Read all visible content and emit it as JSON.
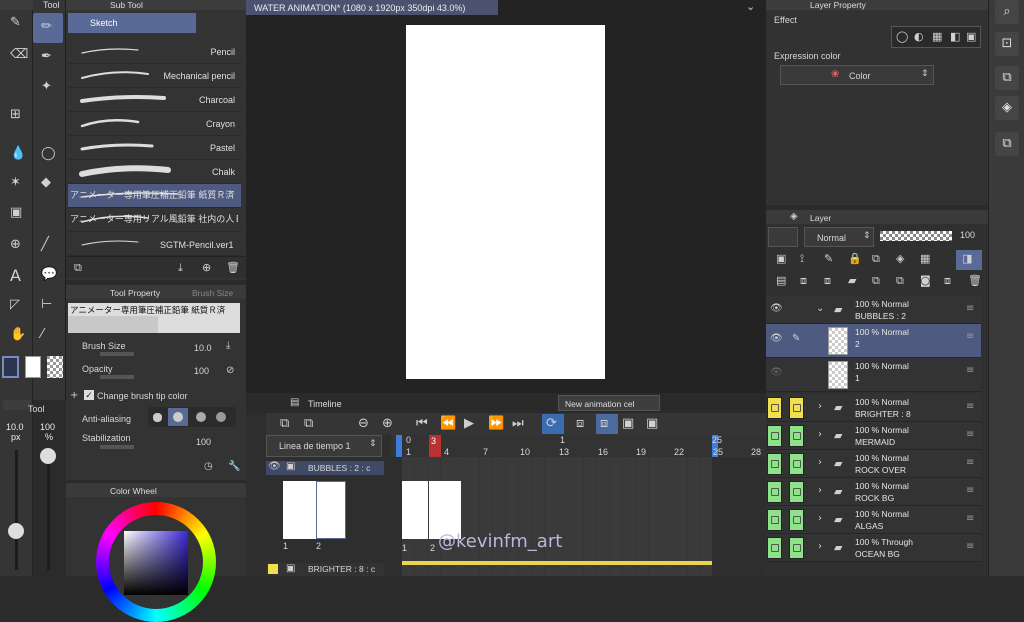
{
  "colors": {
    "accent": "#5a6a96",
    "selection_blue": "#3c7ddc",
    "highlight_red": "#d23c3c",
    "yellow_flag": "#f0e050",
    "green_flag": "#8ee38a"
  },
  "tools": {
    "title": "Tool",
    "icons": [
      "pen-icon",
      "eraser-icon",
      "transform-grid-icon",
      "dropper-fill-icon",
      "magic-wand-icon",
      "gradient-icon",
      "object-select-icon",
      "text-icon",
      "figure-icon",
      "hand-icon"
    ],
    "icons2": [
      "pencil-brush-icon",
      "marker-icon",
      "sparkle-icon",
      "lasso-icon",
      "bucket-icon",
      "line-icon",
      "balloon-icon",
      "ruler-icon",
      "eyedropper-icon"
    ]
  },
  "subtool": {
    "title": "Sub Tool",
    "group": "Sketch",
    "brushes": [
      "Pencil",
      "Mechanical pencil",
      "Charcoal",
      "Crayon",
      "Pastel",
      "Chalk",
      "アニメーター専用筆圧補正鉛筆 紙質Ｒ済",
      "アニメーター専用リアル風鉛筆 社内の人Ｅ",
      "SGTM-Pencil.ver1"
    ],
    "selected_index": 6
  },
  "toolprop": {
    "tab1": "Tool Property",
    "tab2": "Brush Size",
    "preview_name": "アニメーター専用筆圧補正鉛筆 紙質Ｒ済",
    "brush_size_label": "Brush Size",
    "brush_size_value": "10.0",
    "opacity_label": "Opacity",
    "opacity_value": "100",
    "change_tip_label": "Change brush tip color",
    "anti_alias_label": "Anti-aliasing",
    "stabilization_label": "Stabilization",
    "stabilization_value": "100"
  },
  "sizebar": {
    "title": "Tool",
    "size": "10.0",
    "size_unit": "px",
    "opacity": "100",
    "opacity_unit": "%"
  },
  "colorwheel": {
    "title": "Color Wheel"
  },
  "document": {
    "title": "WATER ANIMATION* (1080 x 1920px 350dpi 43.0%)"
  },
  "timeline": {
    "title": "Timeline",
    "tooltip": "New animation cel",
    "track_name": "Linea de tiempo 1",
    "frame_numbers": [
      "0",
      "1",
      "4",
      "7",
      "10",
      "13",
      "16",
      "19",
      "22",
      "25",
      "28"
    ],
    "current_frame": "3",
    "marker_top": "1",
    "marker_end": "25",
    "track_bubbles": "BUBBLES : 2 : c",
    "track_brighter": "BRIGHTER : 8 : c",
    "cel_labels": [
      "1",
      "2"
    ],
    "watermark": "@kevinfm_art"
  },
  "layerprop": {
    "title": "Layer Property",
    "effect_label": "Effect",
    "expression_label": "Expression color",
    "expression_value": "Color"
  },
  "layer": {
    "title": "Layer",
    "blend_mode": "Normal",
    "opacity": "100",
    "rows": [
      {
        "l1": "100 %  Normal",
        "l2": "BUBBLES : 2"
      },
      {
        "l1": "100 %  Normal",
        "l2": "2"
      },
      {
        "l1": "100 %  Normal",
        "l2": "1"
      },
      {
        "l1": "100 %  Normal",
        "l2": "BRIGHTER  : 8"
      },
      {
        "l1": "100 %  Normal",
        "l2": "MERMAID"
      },
      {
        "l1": "100 %  Normal",
        "l2": "ROCK OVER"
      },
      {
        "l1": "100 %  Normal",
        "l2": "ROCK BG"
      },
      {
        "l1": "100 %  Normal",
        "l2": "ALGAS"
      },
      {
        "l1": "100 %  Through",
        "l2": "OCEAN BG"
      }
    ]
  },
  "rightbar": {
    "icons": [
      "search-icon",
      "gallery-icon",
      "material-icon",
      "layers-icon",
      "history-icon"
    ]
  }
}
